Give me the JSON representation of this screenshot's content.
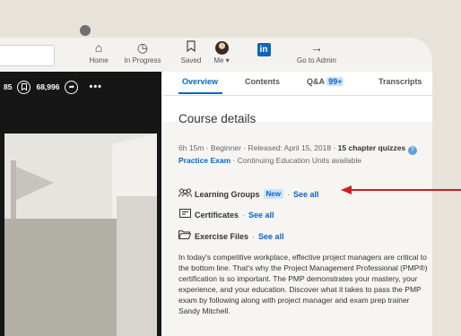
{
  "nav": {
    "home": "Home",
    "in_progress": "In Progress",
    "saved": "Saved",
    "me": "Me ▾",
    "li_logo": "in",
    "go_to_admin": "Go to Admin"
  },
  "video": {
    "left_count": "85",
    "save_count": "68,996",
    "more": "•••"
  },
  "tabs": {
    "overview": "Overview",
    "contents": "Contents",
    "qa": "Q&A",
    "qa_badge": "99+",
    "transcripts": "Transcripts"
  },
  "course": {
    "heading": "Course details",
    "meta_plain": "6h 15m · Beginner · Released: April 15, 2018 · ",
    "meta_bold": "15 chapter quizzes",
    "practice_exam": "Practice Exam",
    "meta_tail": " · Continuing Education Units available",
    "learning_groups": "Learning Groups",
    "new_badge": "New",
    "see_all": "See all",
    "certificates": "Certificates",
    "exercise_files": "Exercise Files",
    "description": "In today's competitive workplace, effective project managers are critical to the bottom line. That's why the Project Management Professional (PMP®) certification is so important. The PMP demonstrates your mastery, your experience, and your education. Discover what it takes to pass the PMP exam by following along with project manager and exam prep trainer Sandy Mitchell."
  },
  "colors": {
    "accent": "#0a66c2",
    "annotation_arrow": "#cc1f1f"
  }
}
